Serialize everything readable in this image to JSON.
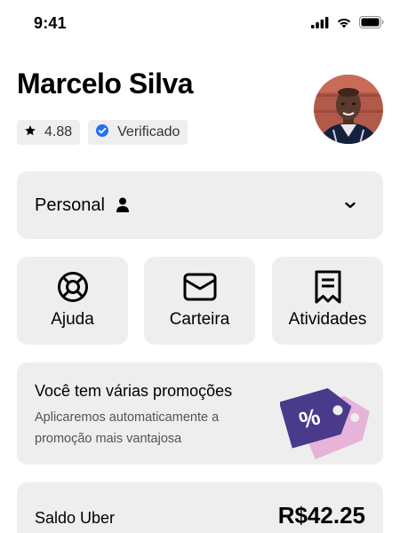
{
  "status_bar": {
    "time": "9:41",
    "icons": [
      "cellular-signal-icon",
      "wifi-icon",
      "battery-icon"
    ]
  },
  "profile": {
    "name": "Marcelo Silva",
    "rating": "4.88",
    "verified_label": "Verificado",
    "verified_color": "#276ef1",
    "rating_icon": "star-icon"
  },
  "profile_selector": {
    "label": "Personal",
    "icon": "person-icon",
    "dropdown_icon": "chevron-down-icon"
  },
  "quick_actions": [
    {
      "label": "Ajuda",
      "icon": "lifebuoy-icon"
    },
    {
      "label": "Carteira",
      "icon": "wallet-icon"
    },
    {
      "label": "Atividades",
      "icon": "receipt-icon"
    }
  ],
  "promo": {
    "title": "Você tem várias promoções",
    "description": "Aplicaremos automaticamente a promoção mais vantajosa",
    "tag_symbol": "%",
    "tag_colors": {
      "front": "#4a3a8c",
      "back": "#e6b3d9"
    }
  },
  "balance": {
    "label": "Saldo Uber",
    "value": "R$42.25"
  }
}
